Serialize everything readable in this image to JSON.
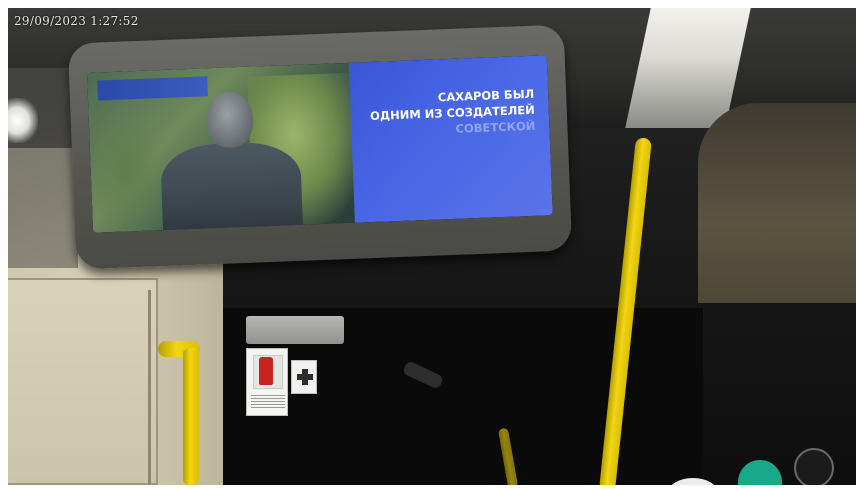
{
  "overlay": {
    "timestamp": "29/09/2023 1:27:52"
  },
  "monitor_screen": {
    "lines": [
      "САХАРОВ БЫЛ",
      "ОДНИМ ИЗ СОЗДАТЕЛЕЙ",
      "СОВЕТСКОЙ"
    ],
    "accent": "#3f5ddc"
  }
}
